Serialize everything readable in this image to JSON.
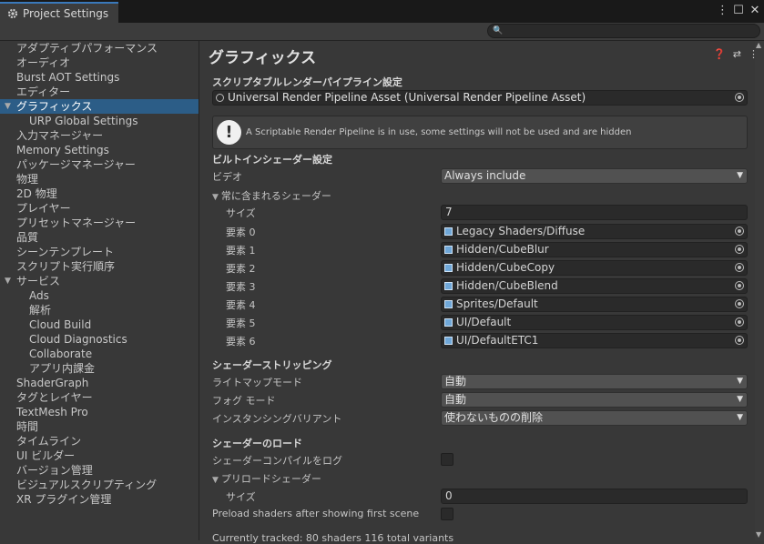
{
  "window": {
    "title": "Project Settings",
    "menu_icon": "⋮",
    "maximize_icon": "☐",
    "close_icon": "✕"
  },
  "search": {
    "placeholder": ""
  },
  "sidebar": {
    "items": [
      {
        "label": "アダプティブパフォーマンス",
        "sub": false,
        "selected": false
      },
      {
        "label": "オーディオ",
        "sub": false,
        "selected": false
      },
      {
        "label": "Burst AOT Settings",
        "sub": false,
        "selected": false
      },
      {
        "label": "エディター",
        "sub": false,
        "selected": false
      },
      {
        "label": "グラフィックス",
        "sub": false,
        "selected": true,
        "folded": true
      },
      {
        "label": "URP Global Settings",
        "sub": true,
        "selected": false
      },
      {
        "label": "入力マネージャー",
        "sub": false,
        "selected": false
      },
      {
        "label": "Memory Settings",
        "sub": false,
        "selected": false
      },
      {
        "label": "パッケージマネージャー",
        "sub": false,
        "selected": false
      },
      {
        "label": "物理",
        "sub": false,
        "selected": false
      },
      {
        "label": "2D 物理",
        "sub": false,
        "selected": false
      },
      {
        "label": "プレイヤー",
        "sub": false,
        "selected": false
      },
      {
        "label": "プリセットマネージャー",
        "sub": false,
        "selected": false
      },
      {
        "label": "品質",
        "sub": false,
        "selected": false
      },
      {
        "label": "シーンテンプレート",
        "sub": false,
        "selected": false
      },
      {
        "label": "スクリプト実行順序",
        "sub": false,
        "selected": false
      },
      {
        "label": "サービス",
        "sub": false,
        "selected": false,
        "folded": true
      },
      {
        "label": "Ads",
        "sub": true,
        "selected": false
      },
      {
        "label": "解析",
        "sub": true,
        "selected": false
      },
      {
        "label": "Cloud Build",
        "sub": true,
        "selected": false
      },
      {
        "label": "Cloud Diagnostics",
        "sub": true,
        "selected": false
      },
      {
        "label": "Collaborate",
        "sub": true,
        "selected": false
      },
      {
        "label": "アプリ内課金",
        "sub": true,
        "selected": false
      },
      {
        "label": "ShaderGraph",
        "sub": false,
        "selected": false
      },
      {
        "label": "タグとレイヤー",
        "sub": false,
        "selected": false
      },
      {
        "label": "TextMesh Pro",
        "sub": false,
        "selected": false
      },
      {
        "label": "時間",
        "sub": false,
        "selected": false
      },
      {
        "label": "タイムライン",
        "sub": false,
        "selected": false
      },
      {
        "label": "UI ビルダー",
        "sub": false,
        "selected": false
      },
      {
        "label": "バージョン管理",
        "sub": false,
        "selected": false
      },
      {
        "label": "ビジュアルスクリプティング",
        "sub": false,
        "selected": false
      },
      {
        "label": "XR プラグイン管理",
        "sub": false,
        "selected": false
      }
    ]
  },
  "main": {
    "title": "グラフィックス",
    "srp_section": "スクリプタブルレンダーパイプライン設定",
    "srp_asset": "Universal Render Pipeline Asset (Universal Render Pipeline Asset)",
    "help_message": "A Scriptable Render Pipeline is in use, some settings will not be used and are hidden",
    "builtin_section": "ビルトインシェーダー設定",
    "video_label": "ビデオ",
    "video_value": "Always include",
    "always_included_label": "常に含まれるシェーダー",
    "size_label": "サイズ",
    "size_value": "7",
    "elements": [
      {
        "label": "要素 0",
        "value": "Legacy Shaders/Diffuse"
      },
      {
        "label": "要素 1",
        "value": "Hidden/CubeBlur"
      },
      {
        "label": "要素 2",
        "value": "Hidden/CubeCopy"
      },
      {
        "label": "要素 3",
        "value": "Hidden/CubeBlend"
      },
      {
        "label": "要素 4",
        "value": "Sprites/Default"
      },
      {
        "label": "要素 5",
        "value": "UI/Default"
      },
      {
        "label": "要素 6",
        "value": "UI/DefaultETC1"
      }
    ],
    "stripping_section": "シェーダーストリッピング",
    "lightmap_label": "ライトマップモード",
    "lightmap_value": "自動",
    "fog_label": "フォグ モード",
    "fog_value": "自動",
    "instancing_label": "インスタンシングバリアント",
    "instancing_value": "使わないものの削除",
    "loading_section": "シェーダーのロード",
    "log_compile_label": "シェーダーコンパイルをログ",
    "preload_label": "プリロードシェーダー",
    "preload_size_label": "サイズ",
    "preload_size_value": "0",
    "preload_after_label": "Preload shaders after showing first scene",
    "tracked_text": "Currently tracked: 80 shaders 116 total variants"
  }
}
